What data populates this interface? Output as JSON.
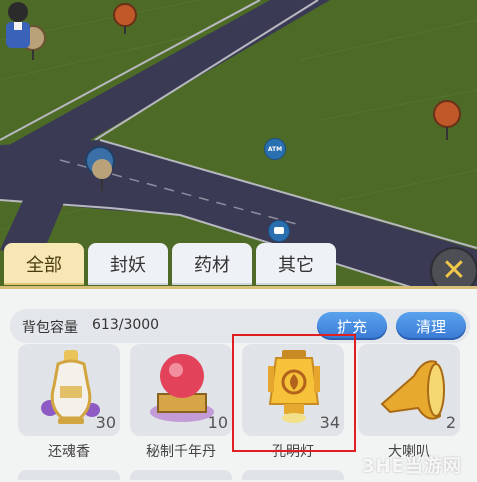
{
  "tabs": [
    {
      "label": "全部",
      "active": true
    },
    {
      "label": "封妖",
      "active": false
    },
    {
      "label": "药材",
      "active": false
    },
    {
      "label": "其它",
      "active": false
    }
  ],
  "map": {
    "atm_label": "ATM"
  },
  "bag": {
    "capacity_label": "背包容量",
    "capacity_value": "613/3000",
    "expand_label": "扩充",
    "clear_label": "清理"
  },
  "items": [
    {
      "name": "还魂香",
      "count": "30",
      "icon": "incense-bottle-icon"
    },
    {
      "name": "秘制千年丹",
      "count": "10",
      "icon": "elixir-orb-icon"
    },
    {
      "name": "孔明灯",
      "count": "34",
      "icon": "sky-lantern-icon"
    },
    {
      "name": "大喇叭",
      "count": "2",
      "icon": "horn-icon"
    }
  ],
  "watermark": "3HE当游网",
  "colors": {
    "accent_button": "#3979d4",
    "active_tab": "#f7e7b4",
    "highlight": "#e02020",
    "close_x": "#f3c84a"
  }
}
